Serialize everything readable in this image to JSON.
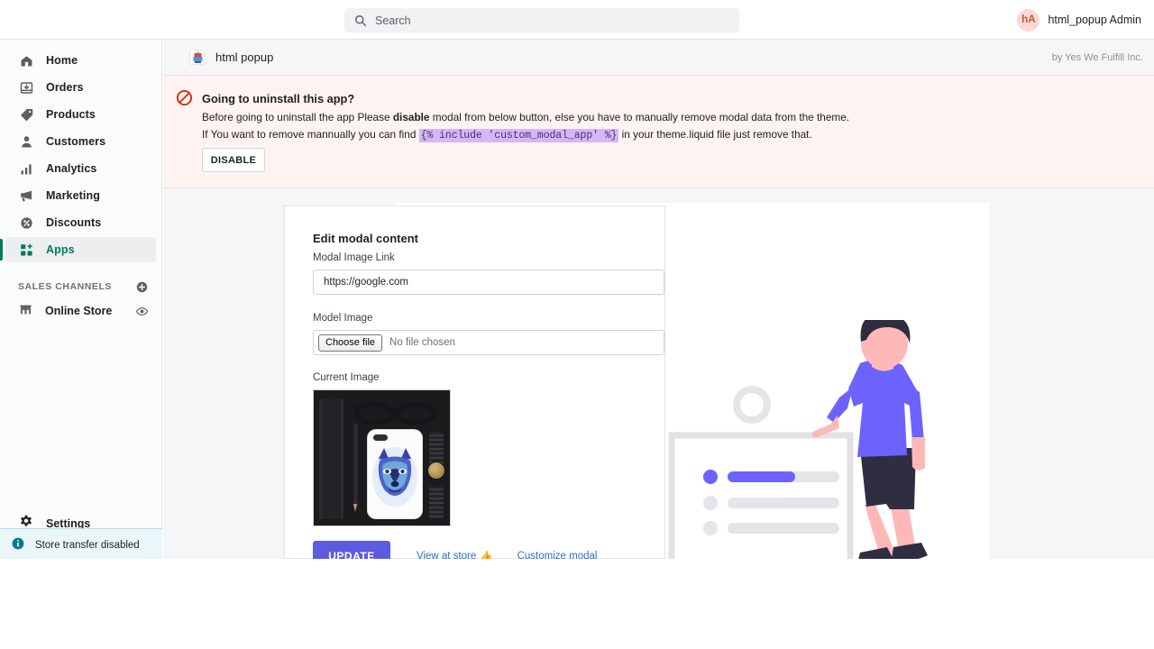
{
  "topbar": {
    "search": {
      "placeholder": "Search",
      "value": "",
      "icon": "search-icon"
    },
    "user": {
      "initials": "hA",
      "name": "html_popup Admin"
    }
  },
  "sidebar": {
    "items": [
      {
        "label": "Home",
        "icon": "home-icon",
        "active": false
      },
      {
        "label": "Orders",
        "icon": "orders-icon",
        "active": false
      },
      {
        "label": "Products",
        "icon": "tag-icon",
        "active": false
      },
      {
        "label": "Customers",
        "icon": "person-icon",
        "active": false
      },
      {
        "label": "Analytics",
        "icon": "bar-chart-icon",
        "active": false
      },
      {
        "label": "Marketing",
        "icon": "megaphone-icon",
        "active": false
      },
      {
        "label": "Discounts",
        "icon": "discount-icon",
        "active": false
      },
      {
        "label": "Apps",
        "icon": "apps-icon",
        "active": true
      }
    ],
    "sales_channels": {
      "title": "SALES CHANNELS",
      "add_icon": "plus-circle-icon",
      "items": [
        {
          "label": "Online Store",
          "icon": "store-icon",
          "trailing_icon": "eye-icon"
        }
      ]
    },
    "settings": {
      "label": "Settings",
      "icon": "gear-icon"
    },
    "store_transfer": {
      "label": "Store transfer disabled",
      "icon": "info-icon",
      "accent": "#007b8f"
    }
  },
  "app_header": {
    "icon": "app-thumbnail-icon",
    "title": "html popup",
    "author": "by Yes We Fulfill Inc."
  },
  "warning": {
    "icon": "no-entry-icon",
    "title": "Going to uninstall this app?",
    "line1_a": "Before going to uninstall the app Please ",
    "line1_b": "disable",
    "line1_c": " modal from below button, else you have to manually remove modal data from the theme.",
    "line2_a": "If You want to remove mannually you can find ",
    "line2_code": "{% include 'custom_modal_app' %}",
    "line2_c": " in your theme.liquid file just remove that.",
    "button": "DISABLE",
    "bg_color": "#fdf3f1",
    "code_bg": "#d7b6f5"
  },
  "form": {
    "title": "Edit modal content",
    "image_link": {
      "label": "Modal Image Link",
      "value": "https://google.com",
      "placeholder": ""
    },
    "model_image": {
      "label": "Model Image",
      "choose_button": "Choose file",
      "status": "No file chosen"
    },
    "current_image": {
      "label": "Current Image",
      "alt": "phone case with blue wolf art flat lay"
    },
    "update_button": "UPDATE",
    "links": [
      {
        "label": "View at store",
        "emoji": "👍"
      },
      {
        "label": "Customize modal",
        "emoji": ""
      }
    ],
    "accent": "#5c5ce0"
  },
  "illustration": {
    "name": "person-walking-past-list-illustration",
    "shirt_color": "#6c63ff",
    "skin_color": "#ffb8b8",
    "hair_color": "#2f2e41",
    "shorts_color": "#2f2e41"
  }
}
